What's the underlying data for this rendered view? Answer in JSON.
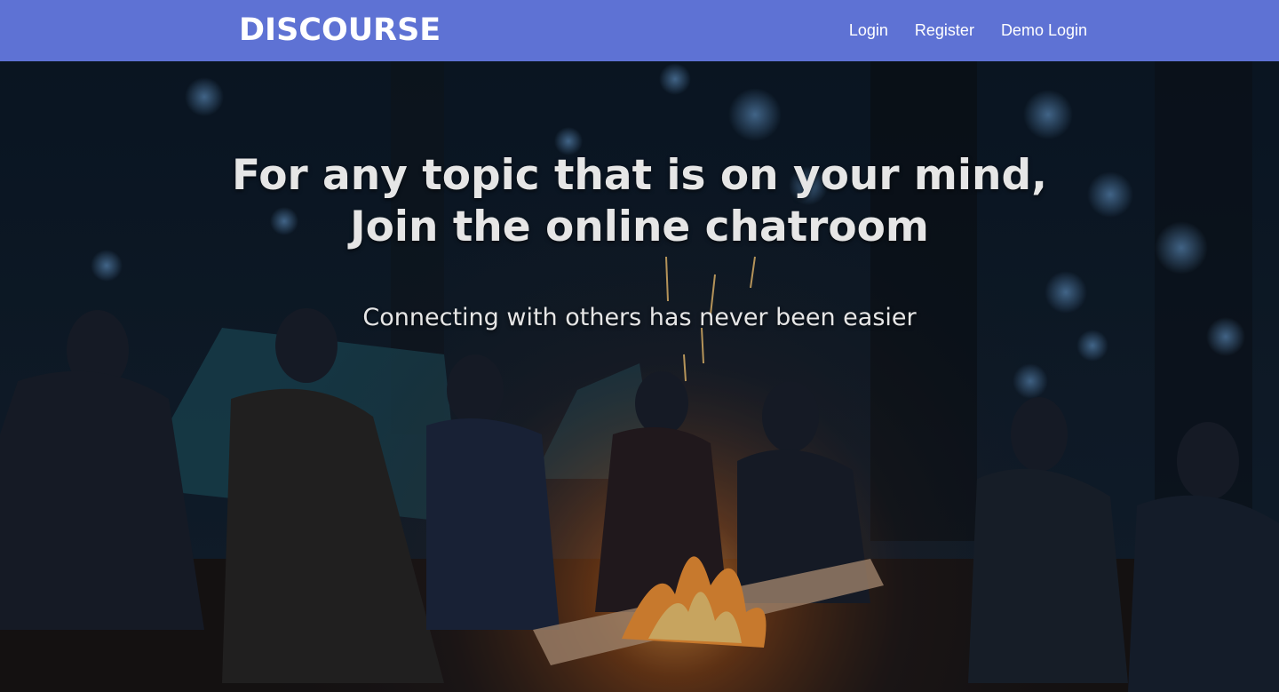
{
  "brand": {
    "name": "DISCOURSE",
    "color": "#5e72d4"
  },
  "nav": {
    "login": "Login",
    "register": "Register",
    "demo_login": "Demo Login"
  },
  "hero": {
    "headline_line1": "For any topic that is on your mind,",
    "headline_line2": "Join the online chatroom",
    "subheadline": "Connecting with others has never been easier",
    "image_alt": "People sitting around a campfire in a forest at night"
  }
}
